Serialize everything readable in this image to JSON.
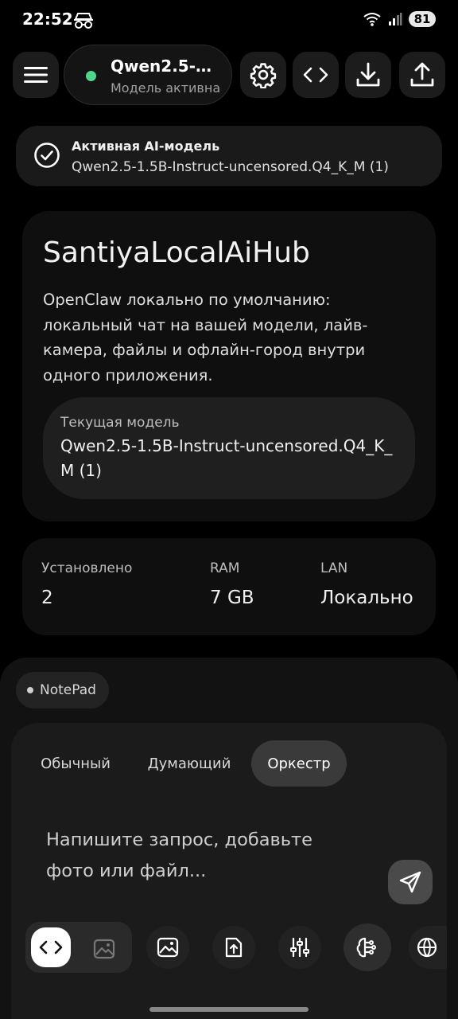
{
  "status_bar": {
    "time": "22:52",
    "battery": "81"
  },
  "top_bar": {
    "model_name": "Qwen2.5-1.5B-Instruct-uncensored.Q4_K_M (1)",
    "model_status": "Модель активна"
  },
  "active_banner": {
    "title": "Активная AI-модель",
    "model": "Qwen2.5-1.5B-Instruct-uncensored.Q4_K_M (1)"
  },
  "hero": {
    "title": "SantiyaLocalAiHub",
    "description": "OpenClaw локально по умолчанию: локальный чат на вашей модели, лайв-камера, файлы и офлайн-город внутри одного приложения.",
    "current_model_label": "Текущая модель",
    "current_model_value": "Qwen2.5-1.5B-Instruct-uncensored.Q4_K_M (1)"
  },
  "stats": [
    {
      "label": "Установлено",
      "value": "2"
    },
    {
      "label": "RAM",
      "value": "7 GB"
    },
    {
      "label": "LAN",
      "value": "Локально"
    }
  ],
  "notepad_chip": "NotePad",
  "modes": [
    {
      "label": "Обычный",
      "active": false
    },
    {
      "label": "Думающий",
      "active": false
    },
    {
      "label": "Оркестр",
      "active": true
    }
  ],
  "composer": {
    "placeholder": "Напишите запрос, добавьте фото или файл..."
  },
  "tools": [
    "code-icon",
    "image-icon",
    "gallery-icon",
    "upload-file-icon",
    "sliders-icon",
    "brain-icon",
    "globe-icon"
  ]
}
